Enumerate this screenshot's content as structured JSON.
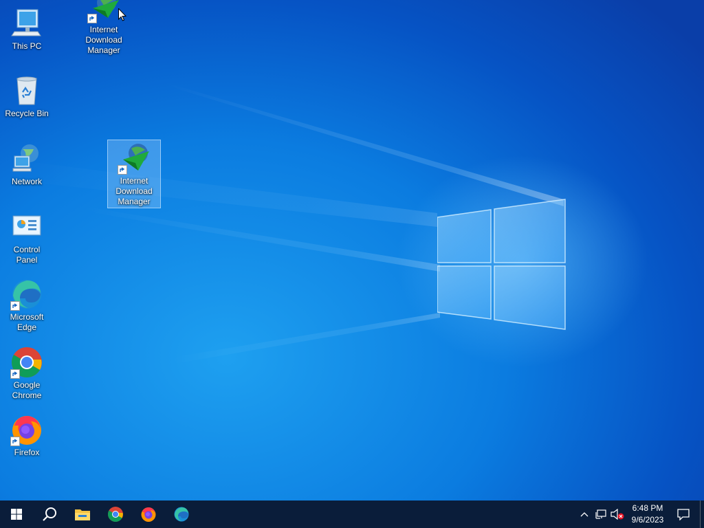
{
  "desktop": {
    "icons": [
      {
        "label": "Internet Download Manager",
        "icon": "idm-icon"
      },
      {
        "label": "This PC",
        "icon": "computer-icon"
      },
      {
        "label": "Recycle Bin",
        "icon": "recycle-bin-icon"
      },
      {
        "label": "Network",
        "icon": "network-icon"
      },
      {
        "label": "Control Panel",
        "icon": "control-panel-icon"
      },
      {
        "label": "Microsoft Edge",
        "icon": "edge-icon"
      },
      {
        "label": "Google Chrome",
        "icon": "chrome-icon"
      },
      {
        "label": "Firefox",
        "icon": "firefox-icon"
      },
      {
        "label": "Internet Download Manager",
        "icon": "idm-icon",
        "selected": true
      }
    ]
  },
  "taskbar": {
    "pinned": [
      "start-icon",
      "search-icon",
      "file-explorer-icon",
      "chrome-icon",
      "firefox-icon",
      "edge-icon"
    ],
    "tray": {
      "icons": [
        "chevron-up-icon",
        "network-wired-icon",
        "volume-muted-icon"
      ],
      "time": "6:48 PM",
      "date": "9/6/2023",
      "notification_icon": "action-center-icon"
    }
  },
  "colors": {
    "wallpaper_primary": "#0b7ce0",
    "taskbar": "#0a1d3a"
  }
}
